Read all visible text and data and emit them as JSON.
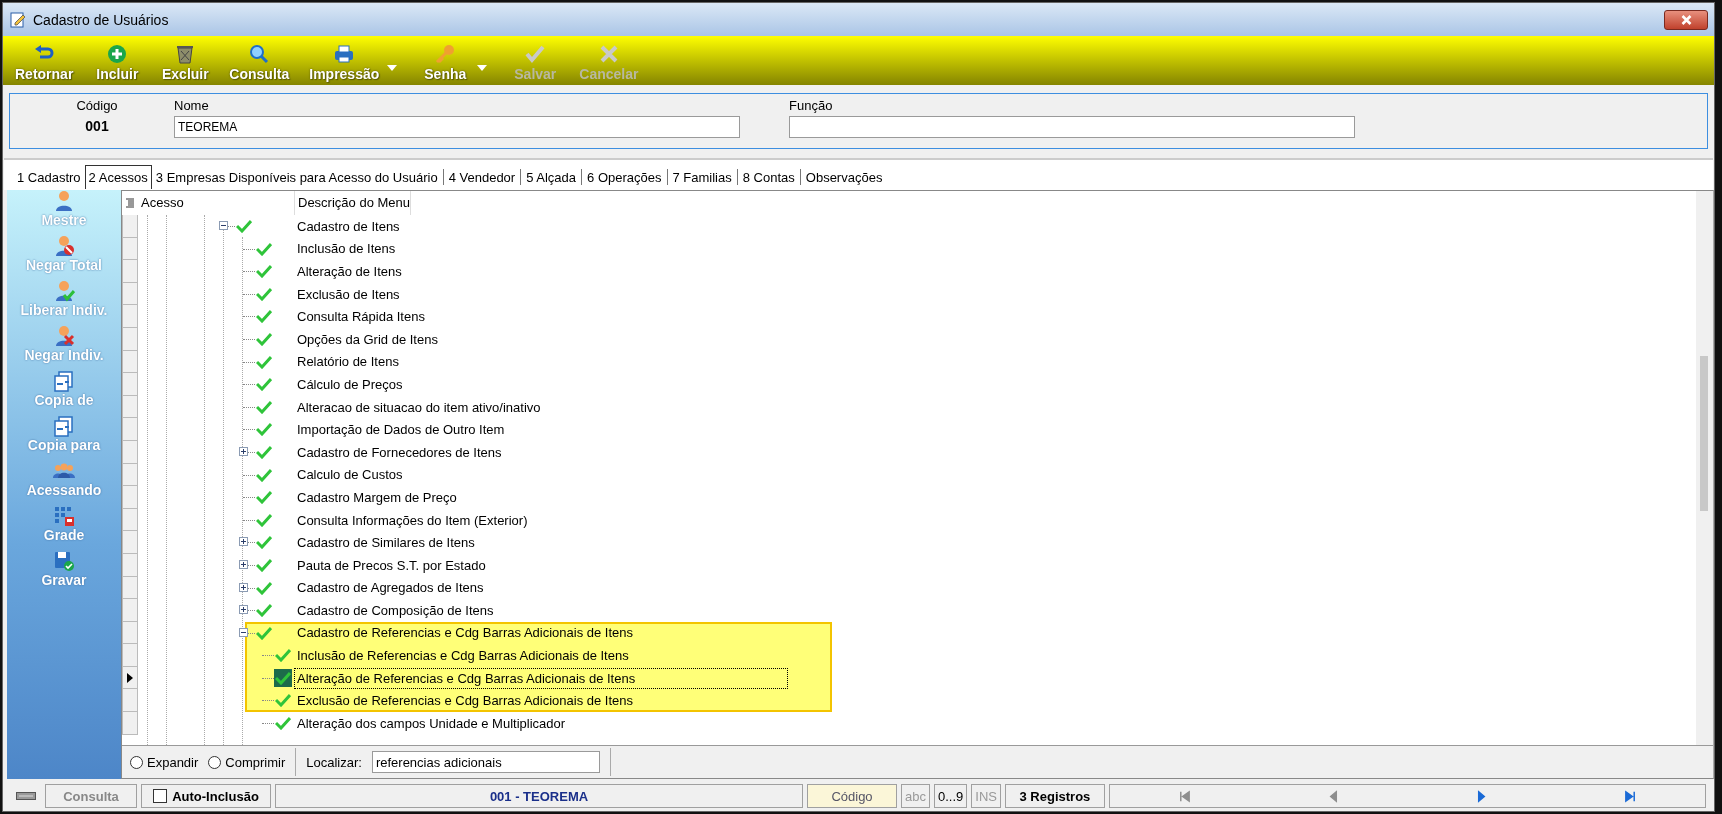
{
  "window": {
    "title": "Cadastro de Usuários"
  },
  "toolbar": [
    {
      "label": "Retornar",
      "kind": "return",
      "disabled": false,
      "dropdown": false
    },
    {
      "label": "Incluir",
      "kind": "add",
      "disabled": false,
      "dropdown": false
    },
    {
      "label": "Excluir",
      "kind": "delete",
      "disabled": false,
      "dropdown": false
    },
    {
      "label": "Consulta",
      "kind": "search",
      "disabled": false,
      "dropdown": false
    },
    {
      "label": "Impressão",
      "kind": "print",
      "disabled": false,
      "dropdown": true
    },
    {
      "label": "Senha",
      "kind": "key",
      "disabled": false,
      "dropdown": true
    },
    {
      "label": "Salvar",
      "kind": "save",
      "disabled": true,
      "dropdown": false
    },
    {
      "label": "Cancelar",
      "kind": "cancel",
      "disabled": true,
      "dropdown": false
    }
  ],
  "record": {
    "codigo": {
      "label": "Código",
      "value": "001"
    },
    "nome": {
      "label": "Nome",
      "value": "TEOREMA"
    },
    "funcao": {
      "label": "Função"
    }
  },
  "tabs": [
    {
      "label": "1 Cadastro",
      "selected": false
    },
    {
      "label": "2 Acessos",
      "selected": true
    },
    {
      "label": "3 Empresas Disponíveis para Acesso do Usuário",
      "selected": false
    },
    {
      "label": "4 Vendedor",
      "selected": false
    },
    {
      "label": "5 Alçada",
      "selected": false
    },
    {
      "label": "6 Operações",
      "selected": false
    },
    {
      "label": "7 Familias",
      "selected": false
    },
    {
      "label": "8 Contas",
      "selected": false
    },
    {
      "label": "Observações",
      "selected": false
    }
  ],
  "sidebar": [
    {
      "label": "Mestre",
      "kind": "user"
    },
    {
      "label": "Negar Total",
      "kind": "user-deny"
    },
    {
      "label": "Liberar Indiv.",
      "kind": "user-allow"
    },
    {
      "label": "Negar Indiv.",
      "kind": "user-remove"
    },
    {
      "label": "Copia de",
      "kind": "copy"
    },
    {
      "label": "Copia para",
      "kind": "copy"
    },
    {
      "label": "Acessando",
      "kind": "group"
    },
    {
      "label": "Grade",
      "kind": "grid"
    },
    {
      "label": "Gravar",
      "kind": "save"
    }
  ],
  "grid": {
    "columns": [
      "Acesso",
      "Descrição do Menu"
    ],
    "tree": [
      {
        "label": "Cadastro de Itens",
        "checked": true,
        "expanded": true,
        "highlighted": false,
        "selected": false,
        "children": [
          {
            "label": "Inclusão de Itens",
            "checked": true,
            "highlighted": false,
            "selected": false
          },
          {
            "label": "Alteração de Itens",
            "checked": true,
            "highlighted": false,
            "selected": false
          },
          {
            "label": "Exclusão de Itens",
            "checked": true,
            "highlighted": false,
            "selected": false
          },
          {
            "label": "Consulta Rápida Itens",
            "checked": true,
            "highlighted": false,
            "selected": false
          },
          {
            "label": "Opções da Grid de Itens",
            "checked": true,
            "highlighted": false,
            "selected": false
          },
          {
            "label": "Relatório de Itens",
            "checked": true,
            "highlighted": false,
            "selected": false
          },
          {
            "label": "Cálculo de Preços",
            "checked": true,
            "highlighted": false,
            "selected": false
          },
          {
            "label": "Alteracao de situacao do item ativo/inativo",
            "checked": true,
            "highlighted": false,
            "selected": false
          },
          {
            "label": "Importação de Dados de Outro Item",
            "checked": true,
            "highlighted": false,
            "selected": false
          },
          {
            "label": "Cadastro de Fornecedores de Itens",
            "checked": true,
            "expanded": false,
            "highlighted": false,
            "selected": false
          },
          {
            "label": "Calculo de Custos",
            "checked": true,
            "highlighted": false,
            "selected": false
          },
          {
            "label": "Cadastro Margem de Preço",
            "checked": true,
            "highlighted": false,
            "selected": false
          },
          {
            "label": "Consulta Informações do Item (Exterior)",
            "checked": true,
            "highlighted": false,
            "selected": false
          },
          {
            "label": "Cadastro de Similares de Itens",
            "checked": true,
            "expanded": false,
            "highlighted": false,
            "selected": false
          },
          {
            "label": "Pauta de Precos S.T. por Estado",
            "checked": true,
            "expanded": false,
            "highlighted": false,
            "selected": false
          },
          {
            "label": "Cadastro de Agregados de Itens",
            "checked": true,
            "expanded": false,
            "highlighted": false,
            "selected": false
          },
          {
            "label": "Cadastro de Composição de Itens",
            "checked": true,
            "expanded": false,
            "highlighted": false,
            "selected": false
          },
          {
            "label": "Cadastro de Referencias e Cdg Barras Adicionais de Itens",
            "checked": true,
            "expanded": true,
            "highlighted": true,
            "selected": false,
            "children": [
              {
                "label": "Inclusão de Referencias e Cdg Barras Adicionais de Itens",
                "checked": true,
                "highlighted": true,
                "selected": false
              },
              {
                "label": "Alteração de Referencias e Cdg Barras Adicionais de Itens",
                "checked": true,
                "highlighted": true,
                "selected": true
              },
              {
                "label": "Exclusão de Referencias e Cdg Barras Adicionais de Itens",
                "checked": true,
                "highlighted": true,
                "selected": false
              },
              {
                "label": "Alteração dos campos Unidade e Multiplicador",
                "checked": true,
                "highlighted": false,
                "selected": false
              }
            ]
          }
        ]
      }
    ]
  },
  "footer": {
    "options": [
      {
        "label": "Expandir",
        "selected": false
      },
      {
        "label": "Comprimir",
        "selected": false
      }
    ],
    "search": {
      "label": "Localizar:",
      "value": "referencias adicionais"
    }
  },
  "status_bar": {
    "mode": "Consulta",
    "auto_inclusao": {
      "label": "Auto-Inclusão",
      "checked": false
    },
    "record": "001 - TEOREMA",
    "order": "Código",
    "indicators": [
      {
        "label": "abc",
        "on": false
      },
      {
        "label": "0...9",
        "on": true
      },
      {
        "label": "INS",
        "on": false
      }
    ],
    "count": "3 Registros",
    "nav": [
      {
        "kind": "first",
        "disabled": true
      },
      {
        "kind": "prev",
        "disabled": true
      },
      {
        "kind": "next",
        "disabled": false
      },
      {
        "kind": "last",
        "disabled": false
      }
    ]
  }
}
